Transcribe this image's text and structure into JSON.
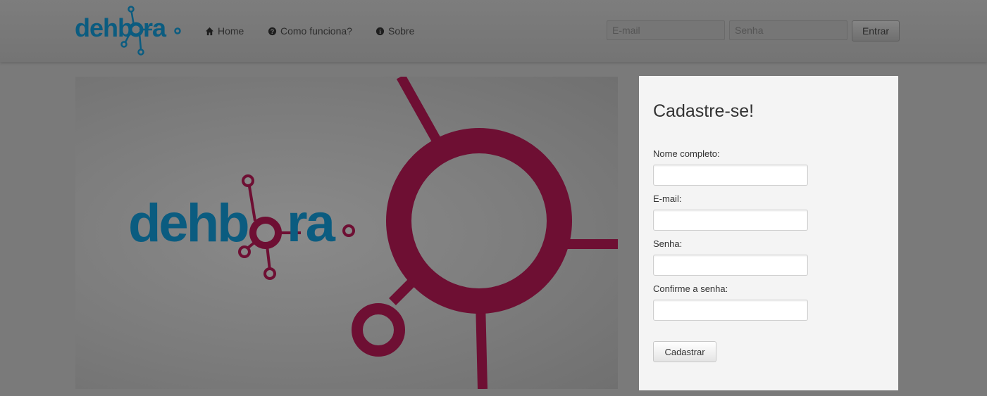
{
  "navbar": {
    "brand_alt": "dehbora",
    "nav": [
      {
        "label": "Home",
        "icon": "home-icon"
      },
      {
        "label": "Como funciona?",
        "icon": "question-icon"
      },
      {
        "label": "Sobre",
        "icon": "info-icon"
      }
    ],
    "login": {
      "email_placeholder": "E-mail",
      "password_placeholder": "Senha",
      "submit_label": "Entrar"
    }
  },
  "hero": {
    "logo_text": "dehbora",
    "accent_color": "#6e0f33",
    "logo_color": "#0b5c80"
  },
  "signup": {
    "title": "Cadastre-se!",
    "fields": [
      {
        "label": "Nome completo:"
      },
      {
        "label": "E-mail:"
      },
      {
        "label": "Senha:"
      },
      {
        "label": "Confirme a senha:"
      }
    ],
    "submit_label": "Cadastrar"
  }
}
